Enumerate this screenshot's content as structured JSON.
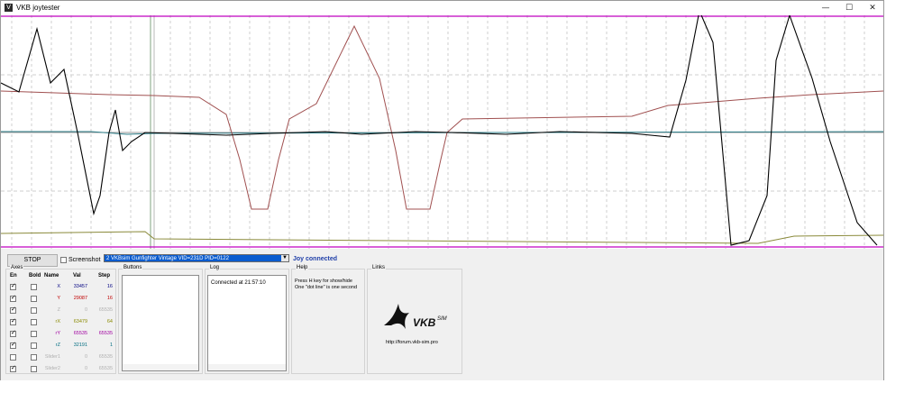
{
  "window": {
    "title": "VKB joytester",
    "app_icon": "V"
  },
  "window_controls": {
    "minimize": "—",
    "maximize": "☐",
    "close": "✕"
  },
  "controls": {
    "stop_label": "STOP",
    "screenshot_label": "Screenshot",
    "device_selected": "2 VKBsim Gunfighter Vintage  VID=231D PID=0122",
    "status": "Joy connected"
  },
  "axes": {
    "title": "Axes",
    "headers": {
      "en": "En",
      "bold": "Bold",
      "name": "Name",
      "val": "Val",
      "step": "Step"
    },
    "rows": [
      {
        "name": "X",
        "val": "33457",
        "step": "16",
        "en": true,
        "bold": false,
        "color": "#000080"
      },
      {
        "name": "Y",
        "val": "29087",
        "step": "16",
        "en": true,
        "bold": false,
        "color": "#c00000"
      },
      {
        "name": "Z",
        "val": "0",
        "step": "65535",
        "en": true,
        "bold": false,
        "color": "#b0b0b0"
      },
      {
        "name": "rX",
        "val": "63479",
        "step": "64",
        "en": true,
        "bold": false,
        "color": "#8a8a00"
      },
      {
        "name": "rY",
        "val": "65535",
        "step": "65535",
        "en": true,
        "bold": false,
        "color": "#a000a0"
      },
      {
        "name": "rZ",
        "val": "32191",
        "step": "1",
        "en": true,
        "bold": false,
        "color": "#006d80"
      },
      {
        "name": "Slider1",
        "val": "0",
        "step": "65535",
        "en": false,
        "bold": false,
        "color": "#b0b0b0"
      },
      {
        "name": "Slider2",
        "val": "0",
        "step": "65535",
        "en": true,
        "bold": false,
        "color": "#b0b0b0"
      }
    ]
  },
  "buttons_group": {
    "title": "Buttons"
  },
  "log_group": {
    "title": "Log",
    "entries": [
      "Connected at 21:57:10"
    ]
  },
  "help_group": {
    "title": "Help",
    "line1": "Press H key for show/hide",
    "line2": "One \"dot line\" is one second"
  },
  "links_group": {
    "title": "Links",
    "logo_text": "VKB",
    "logo_sup": "SIM",
    "url": "http://forum.vkb-sim.pro"
  }
}
